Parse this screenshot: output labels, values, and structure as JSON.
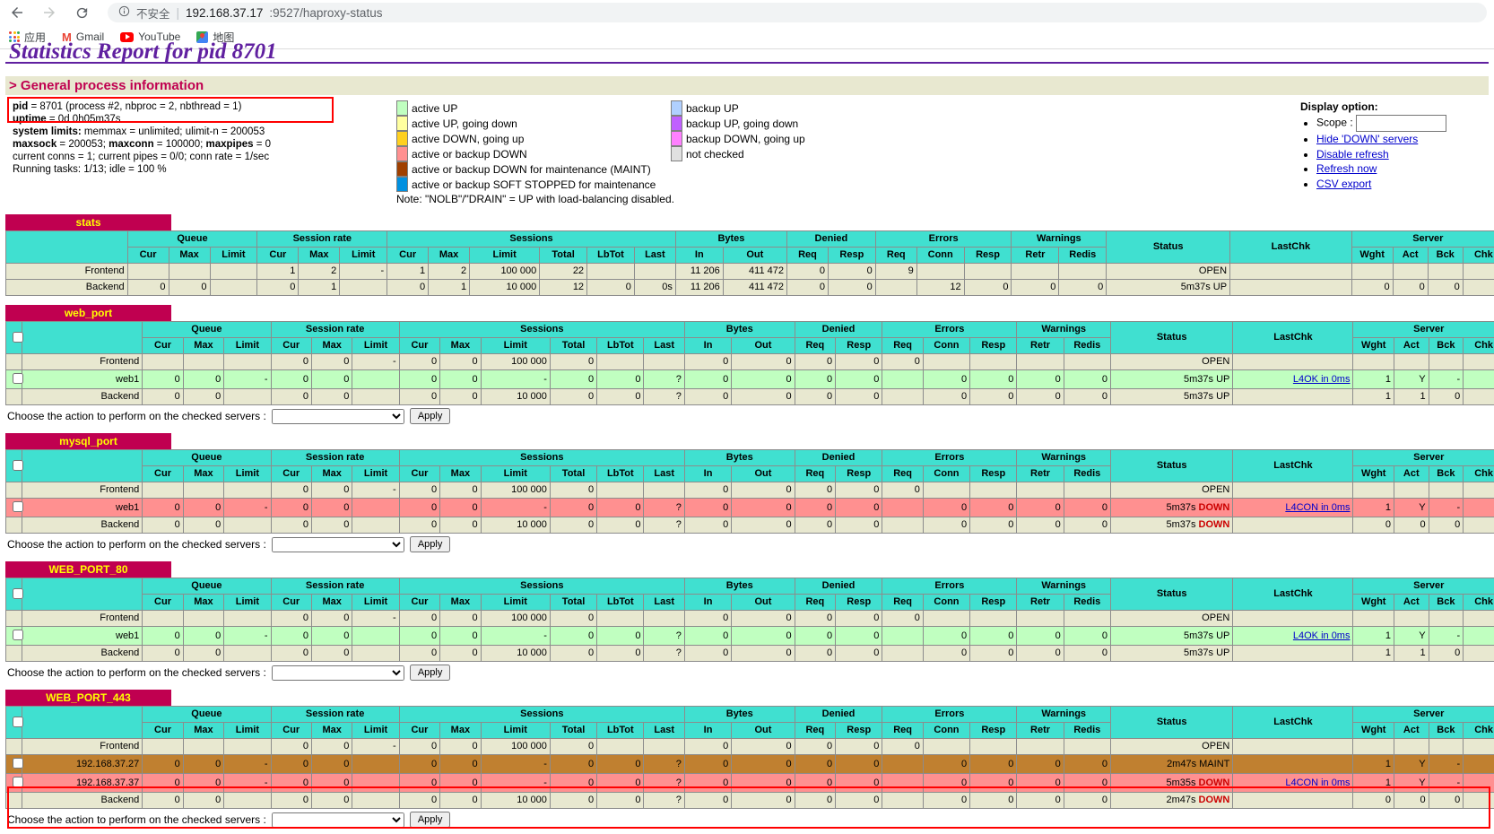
{
  "browser": {
    "back_icon": "arrow-left-icon",
    "forward_icon": "arrow-right-icon",
    "reload_icon": "reload-icon",
    "info_icon": "info-circle-icon",
    "security_label": "不安全",
    "url_host": "192.168.37.17",
    "url_rest": ":9527/haproxy-status",
    "bookmarks": [
      {
        "label": "应用",
        "icon": "apps-grid-icon"
      },
      {
        "label": "Gmail",
        "icon": "gmail-icon"
      },
      {
        "label": "YouTube",
        "icon": "youtube-icon"
      },
      {
        "label": "地图",
        "icon": "maps-icon"
      }
    ]
  },
  "page": {
    "title": "Statistics Report for pid 8701",
    "section_heading": "> General process information"
  },
  "process_info": {
    "lines": [
      "pid = 8701 (process #2, nbproc = 2, nbthread = 1)",
      "uptime = 0d 0h05m37s",
      "system limits: memmax = unlimited; ulimit-n = 200053",
      "maxsock = 200053; maxconn = 100000; maxpipes = 0",
      "current conns = 1; current pipes = 0/0; conn rate = 1/sec",
      "Running tasks: 1/13; idle = 100 %"
    ]
  },
  "legend": {
    "left": [
      {
        "label": "active UP",
        "color": "#c0ffc0"
      },
      {
        "label": "active UP, going down",
        "color": "#ffffa0"
      },
      {
        "label": "active DOWN, going up",
        "color": "#ffd020"
      },
      {
        "label": "active or backup DOWN",
        "color": "#ff9090"
      },
      {
        "label": "active or backup DOWN for maintenance (MAINT)",
        "color": "#a04000"
      },
      {
        "label": "active or backup SOFT STOPPED for maintenance",
        "color": "#0090e0"
      }
    ],
    "right": [
      {
        "label": "backup UP",
        "color": "#b0d0ff"
      },
      {
        "label": "backup UP, going down",
        "color": "#c060ff"
      },
      {
        "label": "backup DOWN, going up",
        "color": "#ff80ff"
      },
      {
        "label": "not checked",
        "color": "#e0e0e0"
      }
    ],
    "note": "Note: \"NOLB\"/\"DRAIN\" = UP with load-balancing disabled."
  },
  "display_option": {
    "title": "Display option:",
    "scope_label": "Scope :",
    "scope_value": "",
    "links": [
      "Hide 'DOWN' servers",
      "Disable refresh",
      "Refresh now",
      "CSV export"
    ]
  },
  "table_headers": {
    "groups": [
      "Queue",
      "Session rate",
      "Sessions",
      "Bytes",
      "Denied",
      "Errors",
      "Warnings",
      "Server"
    ],
    "queue": [
      "Cur",
      "Max",
      "Limit"
    ],
    "session_rate": [
      "Cur",
      "Max",
      "Limit"
    ],
    "sessions": [
      "Cur",
      "Max",
      "Limit",
      "Total",
      "LbTot",
      "Last"
    ],
    "bytes": [
      "In",
      "Out"
    ],
    "denied": [
      "Req",
      "Resp"
    ],
    "errors": [
      "Req",
      "Conn",
      "Resp"
    ],
    "warnings": [
      "Retr",
      "Redis"
    ],
    "status": "Status",
    "lastchk": "LastChk",
    "server": [
      "Wght",
      "Act",
      "Bck",
      "Chk"
    ]
  },
  "action_bar": {
    "label": "Choose the action to perform on the checked servers :",
    "select_value": "",
    "apply_label": "Apply"
  },
  "proxies": [
    {
      "name": "stats",
      "has_checkbox": false,
      "rows": [
        {
          "type": "frontend",
          "name": "Frontend",
          "q": [
            "",
            "",
            ""
          ],
          "sr": [
            "1",
            "2",
            "-"
          ],
          "sess": [
            "1",
            "2",
            "100 000",
            "22",
            "",
            ""
          ],
          "bytes": [
            "11 206",
            "411 472"
          ],
          "denied": [
            "0",
            "0"
          ],
          "errors": [
            "9",
            "",
            ""
          ],
          "warn": [
            "",
            ""
          ],
          "status": "OPEN",
          "lastchk": "",
          "srv": [
            "",
            "",
            "",
            ""
          ]
        },
        {
          "type": "backend",
          "name": "Backend",
          "q": [
            "0",
            "0",
            ""
          ],
          "sr": [
            "0",
            "1",
            ""
          ],
          "sess": [
            "0",
            "1",
            "10 000",
            "12",
            "0",
            "0s"
          ],
          "bytes": [
            "11 206",
            "411 472"
          ],
          "denied": [
            "0",
            "0"
          ],
          "errors": [
            "",
            "12",
            "0"
          ],
          "warn": [
            "0",
            "0"
          ],
          "status": "5m37s UP",
          "lastchk": "",
          "srv": [
            "0",
            "0",
            "0",
            ""
          ]
        }
      ]
    },
    {
      "name": "web_port",
      "has_checkbox": true,
      "rows": [
        {
          "type": "frontend",
          "name": "Frontend",
          "q": [
            "",
            "",
            ""
          ],
          "sr": [
            "0",
            "0",
            "-"
          ],
          "sess": [
            "0",
            "0",
            "100 000",
            "0",
            "",
            ""
          ],
          "bytes": [
            "0",
            "0"
          ],
          "denied": [
            "0",
            "0"
          ],
          "errors": [
            "0",
            "",
            ""
          ],
          "warn": [
            "",
            ""
          ],
          "status": "OPEN",
          "lastchk": "",
          "srv": [
            "",
            "",
            "",
            ""
          ]
        },
        {
          "type": "up",
          "name": "web1",
          "checkbox": true,
          "q": [
            "0",
            "0",
            "-"
          ],
          "sr": [
            "0",
            "0",
            ""
          ],
          "sess": [
            "0",
            "0",
            "-",
            "0",
            "0",
            "?"
          ],
          "bytes": [
            "0",
            "0"
          ],
          "denied": [
            "0",
            "",
            "0"
          ],
          "errors": [
            "",
            "0",
            "0"
          ],
          "warn": [
            "0",
            "0"
          ],
          "status": "5m37s UP",
          "lastchk": "L4OK in 0ms",
          "srv": [
            "1",
            "Y",
            "-",
            ""
          ]
        },
        {
          "type": "backend",
          "name": "Backend",
          "q": [
            "0",
            "0",
            ""
          ],
          "sr": [
            "0",
            "0",
            ""
          ],
          "sess": [
            "0",
            "0",
            "10 000",
            "0",
            "0",
            "?"
          ],
          "bytes": [
            "0",
            "0"
          ],
          "denied": [
            "0",
            "0"
          ],
          "errors": [
            "",
            "0",
            "0"
          ],
          "warn": [
            "0",
            "0"
          ],
          "status": "5m37s UP",
          "lastchk": "",
          "srv": [
            "1",
            "1",
            "0",
            ""
          ]
        }
      ]
    },
    {
      "name": "mysql_port",
      "has_checkbox": true,
      "rows": [
        {
          "type": "frontend",
          "name": "Frontend",
          "q": [
            "",
            "",
            ""
          ],
          "sr": [
            "0",
            "0",
            "-"
          ],
          "sess": [
            "0",
            "0",
            "100 000",
            "0",
            "",
            ""
          ],
          "bytes": [
            "0",
            "0"
          ],
          "denied": [
            "0",
            "0"
          ],
          "errors": [
            "0",
            "",
            ""
          ],
          "warn": [
            "",
            ""
          ],
          "status": "OPEN",
          "lastchk": "",
          "srv": [
            "",
            "",
            "",
            ""
          ]
        },
        {
          "type": "down",
          "name": "web1",
          "checkbox": true,
          "q": [
            "0",
            "0",
            "-"
          ],
          "sr": [
            "0",
            "0",
            ""
          ],
          "sess": [
            "0",
            "0",
            "-",
            "0",
            "0",
            "?"
          ],
          "bytes": [
            "0",
            "0"
          ],
          "denied": [
            "0",
            "",
            "0"
          ],
          "errors": [
            "",
            "0",
            "0"
          ],
          "warn": [
            "0",
            "0"
          ],
          "status": "5m37s DOWN",
          "status_down": true,
          "lastchk": "L4CON in 0ms",
          "srv": [
            "1",
            "Y",
            "-",
            ""
          ]
        },
        {
          "type": "backend",
          "name": "Backend",
          "q": [
            "0",
            "0",
            ""
          ],
          "sr": [
            "0",
            "0",
            ""
          ],
          "sess": [
            "0",
            "0",
            "10 000",
            "0",
            "0",
            "?"
          ],
          "bytes": [
            "0",
            "0"
          ],
          "denied": [
            "0",
            "0"
          ],
          "errors": [
            "",
            "0",
            "0"
          ],
          "warn": [
            "0",
            "0"
          ],
          "status": "5m37s DOWN",
          "status_down": true,
          "lastchk": "",
          "srv": [
            "0",
            "0",
            "0",
            ""
          ]
        }
      ]
    },
    {
      "name": "WEB_PORT_80",
      "has_checkbox": true,
      "rows": [
        {
          "type": "frontend",
          "name": "Frontend",
          "q": [
            "",
            "",
            ""
          ],
          "sr": [
            "0",
            "0",
            "-"
          ],
          "sess": [
            "0",
            "0",
            "100 000",
            "0",
            "",
            ""
          ],
          "bytes": [
            "0",
            "0"
          ],
          "denied": [
            "0",
            "0"
          ],
          "errors": [
            "0",
            "",
            ""
          ],
          "warn": [
            "",
            ""
          ],
          "status": "OPEN",
          "lastchk": "",
          "srv": [
            "",
            "",
            "",
            ""
          ]
        },
        {
          "type": "up",
          "name": "web1",
          "checkbox": true,
          "q": [
            "0",
            "0",
            "-"
          ],
          "sr": [
            "0",
            "0",
            ""
          ],
          "sess": [
            "0",
            "0",
            "-",
            "0",
            "0",
            "?"
          ],
          "bytes": [
            "0",
            "0"
          ],
          "denied": [
            "0",
            "",
            "0"
          ],
          "errors": [
            "",
            "0",
            "0"
          ],
          "warn": [
            "0",
            "0"
          ],
          "status": "5m37s UP",
          "lastchk": "L4OK in 0ms",
          "srv": [
            "1",
            "Y",
            "-",
            ""
          ]
        },
        {
          "type": "backend",
          "name": "Backend",
          "q": [
            "0",
            "0",
            ""
          ],
          "sr": [
            "0",
            "0",
            ""
          ],
          "sess": [
            "0",
            "0",
            "10 000",
            "0",
            "0",
            "?"
          ],
          "bytes": [
            "0",
            "0"
          ],
          "denied": [
            "0",
            "0"
          ],
          "errors": [
            "",
            "0",
            "0"
          ],
          "warn": [
            "0",
            "0"
          ],
          "status": "5m37s UP",
          "lastchk": "",
          "srv": [
            "1",
            "1",
            "0",
            ""
          ]
        }
      ]
    },
    {
      "name": "WEB_PORT_443",
      "has_checkbox": true,
      "rows": [
        {
          "type": "frontend",
          "name": "Frontend",
          "q": [
            "",
            "",
            ""
          ],
          "sr": [
            "0",
            "0",
            "-"
          ],
          "sess": [
            "0",
            "0",
            "100 000",
            "0",
            "",
            ""
          ],
          "bytes": [
            "0",
            "0"
          ],
          "denied": [
            "0",
            "0"
          ],
          "errors": [
            "0",
            "",
            ""
          ],
          "warn": [
            "",
            ""
          ],
          "status": "OPEN",
          "lastchk": "",
          "srv": [
            "",
            "",
            "",
            ""
          ]
        },
        {
          "type": "maint",
          "name": "192.168.37.27",
          "checkbox": true,
          "q": [
            "0",
            "0",
            "-"
          ],
          "sr": [
            "0",
            "0",
            ""
          ],
          "sess": [
            "0",
            "0",
            "-",
            "0",
            "0",
            "?"
          ],
          "bytes": [
            "0",
            "0"
          ],
          "denied": [
            "0",
            "",
            "0"
          ],
          "errors": [
            "",
            "0",
            "0"
          ],
          "warn": [
            "0",
            "0"
          ],
          "status": "2m47s MAINT",
          "lastchk": "",
          "srv": [
            "1",
            "Y",
            "-",
            ""
          ]
        },
        {
          "type": "down",
          "name": "192.168.37.37",
          "checkbox": true,
          "q": [
            "0",
            "0",
            "-"
          ],
          "sr": [
            "0",
            "0",
            ""
          ],
          "sess": [
            "0",
            "0",
            "-",
            "0",
            "0",
            "?"
          ],
          "bytes": [
            "0",
            "0"
          ],
          "denied": [
            "0",
            "",
            "0"
          ],
          "errors": [
            "",
            "0",
            "0"
          ],
          "warn": [
            "0",
            "0"
          ],
          "status": "5m35s DOWN",
          "status_down": true,
          "lastchk": "L4CON in 0ms",
          "srv": [
            "1",
            "Y",
            "-",
            ""
          ]
        },
        {
          "type": "backend",
          "name": "Backend",
          "q": [
            "0",
            "0",
            ""
          ],
          "sr": [
            "0",
            "0",
            ""
          ],
          "sess": [
            "0",
            "0",
            "10 000",
            "0",
            "0",
            "?"
          ],
          "bytes": [
            "0",
            "0"
          ],
          "denied": [
            "0",
            "0"
          ],
          "errors": [
            "",
            "0",
            "0"
          ],
          "warn": [
            "0",
            "0"
          ],
          "status": "2m47s DOWN",
          "status_down": true,
          "lastchk": "",
          "srv": [
            "0",
            "0",
            "0",
            ""
          ]
        }
      ]
    }
  ]
}
